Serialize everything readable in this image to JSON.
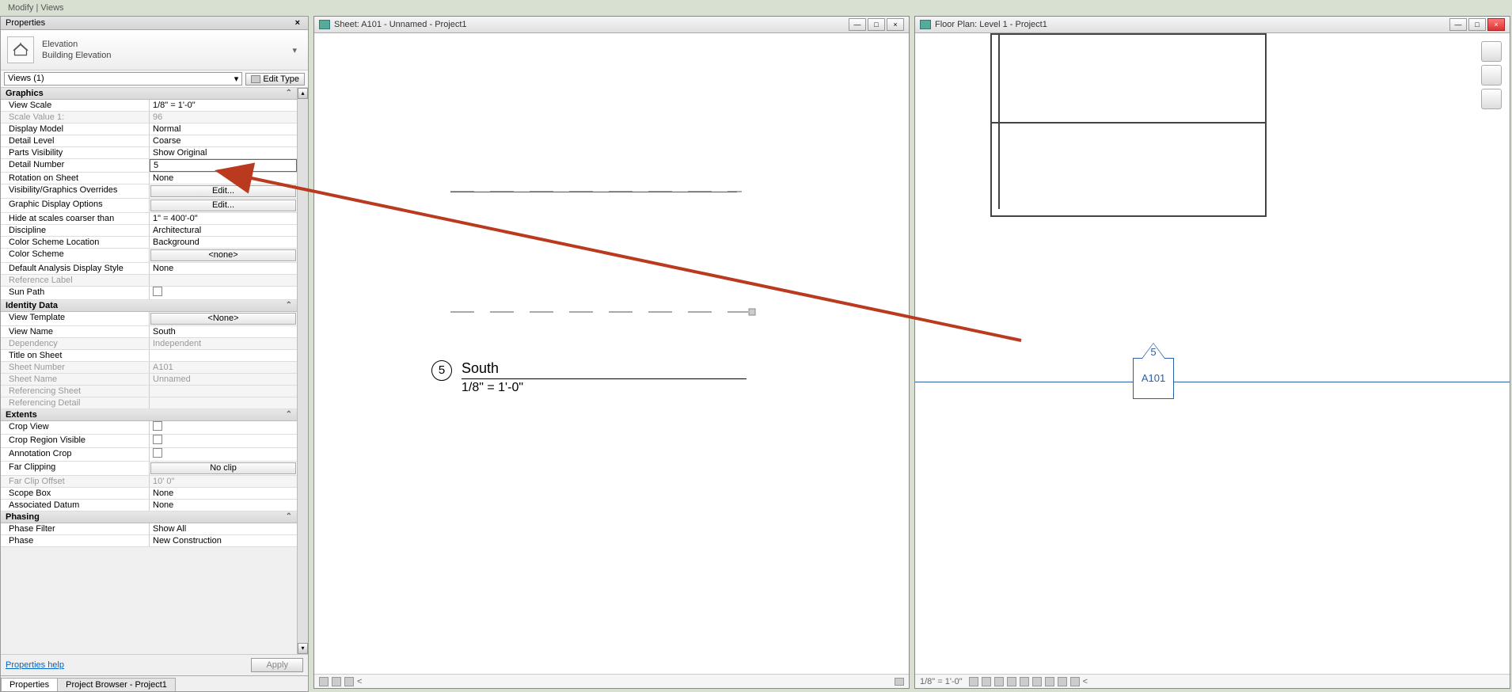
{
  "app": {
    "title": "Modify | Views"
  },
  "panel": {
    "title": "Properties",
    "type_line1": "Elevation",
    "type_line2": "Building Elevation",
    "filter": "Views (1)",
    "edit_type": "Edit Type",
    "help": "Properties help",
    "apply": "Apply"
  },
  "groups": {
    "g1": "Graphics",
    "g2": "Identity Data",
    "g3": "Extents",
    "g4": "Phasing"
  },
  "props": {
    "view_scale_l": "View Scale",
    "view_scale_v": "1/8\" = 1'-0\"",
    "scale_value_l": "Scale Value    1:",
    "scale_value_v": "96",
    "display_model_l": "Display Model",
    "display_model_v": "Normal",
    "detail_level_l": "Detail Level",
    "detail_level_v": "Coarse",
    "parts_vis_l": "Parts Visibility",
    "parts_vis_v": "Show Original",
    "detail_num_l": "Detail Number",
    "detail_num_v": "5",
    "rotation_l": "Rotation on Sheet",
    "rotation_v": "None",
    "vg_override_l": "Visibility/Graphics Overrides",
    "vg_override_v": "Edit...",
    "gdo_l": "Graphic Display Options",
    "gdo_v": "Edit...",
    "hide_coarser_l": "Hide at scales coarser than",
    "hide_coarser_v": "1\" = 400'-0\"",
    "discipline_l": "Discipline",
    "discipline_v": "Architectural",
    "csl_l": "Color Scheme Location",
    "csl_v": "Background",
    "cs_l": "Color Scheme",
    "cs_v": "<none>",
    "dads_l": "Default Analysis Display Style",
    "dads_v": "None",
    "ref_label_l": "Reference Label",
    "ref_label_v": "",
    "sunpath_l": "Sun Path",
    "vt_l": "View Template",
    "vt_v": "<None>",
    "vn_l": "View Name",
    "vn_v": "South",
    "dep_l": "Dependency",
    "dep_v": "Independent",
    "tos_l": "Title on Sheet",
    "tos_v": "",
    "sn_l": "Sheet Number",
    "sn_v": "A101",
    "sname_l": "Sheet Name",
    "sname_v": "Unnamed",
    "refsh_l": "Referencing Sheet",
    "refdet_l": "Referencing Detail",
    "cv_l": "Crop View",
    "crv_l": "Crop Region Visible",
    "ac_l": "Annotation Crop",
    "fc_l": "Far Clipping",
    "fc_v": "No clip",
    "fco_l": "Far Clip Offset",
    "fco_v": "10'  0\"",
    "sb_l": "Scope Box",
    "sb_v": "None",
    "ad_l": "Associated Datum",
    "ad_v": "None",
    "pf_l": "Phase Filter",
    "pf_v": "Show All",
    "ph_l": "Phase",
    "ph_v": "New Construction"
  },
  "tabs": {
    "t1": "Properties",
    "t2": "Project Browser - Project1"
  },
  "view1": {
    "title": "Sheet: A101 - Unnamed - Project1",
    "detail_num": "5",
    "view_name": "South",
    "scale": "1/8\" = 1'-0\""
  },
  "view2": {
    "title": "Floor Plan: Level 1 - Project1",
    "callout_num": "5",
    "callout_sheet": "A101",
    "status_scale": "1/8\" = 1'-0\""
  }
}
